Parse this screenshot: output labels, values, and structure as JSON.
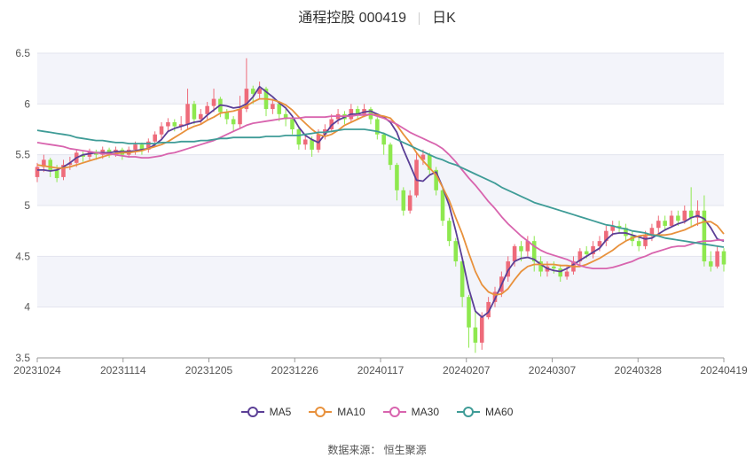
{
  "title": {
    "name": "通程控股 000419",
    "period": "日K"
  },
  "source": "数据来源： 恒生聚源",
  "chart_data": {
    "type": "candlestick",
    "ylim": [
      3.5,
      6.5
    ],
    "yticks": [
      3.5,
      4,
      4.5,
      5,
      5.5,
      6,
      6.5
    ],
    "xticks": [
      "20231024",
      "20231114",
      "20231205",
      "20231226",
      "20240117",
      "20240207",
      "20240307",
      "20240328",
      "20240419"
    ],
    "grid": true,
    "legend_position": "bottom",
    "colors": {
      "up": "#ee6b7a",
      "down": "#8ee84f",
      "band": "#f3f4fa"
    },
    "series": [
      {
        "name": "MA5",
        "color": "#5b3f96",
        "values": [
          5.35,
          5.35,
          5.34,
          5.35,
          5.38,
          5.42,
          5.47,
          5.5,
          5.51,
          5.52,
          5.52,
          5.52,
          5.53,
          5.53,
          5.53,
          5.54,
          5.55,
          5.56,
          5.6,
          5.65,
          5.73,
          5.76,
          5.78,
          5.8,
          5.82,
          5.83,
          5.89,
          5.94,
          5.99,
          5.98,
          5.96,
          5.97,
          6.0,
          6.07,
          6.17,
          6.12,
          6.07,
          6.01,
          5.96,
          5.88,
          5.77,
          5.69,
          5.65,
          5.62,
          5.7,
          5.79,
          5.84,
          5.87,
          5.9,
          5.9,
          5.92,
          5.93,
          5.9,
          5.87,
          5.82,
          5.72,
          5.55,
          5.4,
          5.25,
          5.24,
          5.3,
          5.33,
          5.18,
          5.0,
          4.75,
          4.48,
          4.18,
          3.96,
          3.9,
          3.95,
          4.08,
          4.22,
          4.36,
          4.45,
          4.48,
          4.49,
          4.47,
          4.42,
          4.38,
          4.36,
          4.35,
          4.38,
          4.42,
          4.46,
          4.5,
          4.54,
          4.58,
          4.66,
          4.72,
          4.73,
          4.73,
          4.71,
          4.69,
          4.67,
          4.68,
          4.72,
          4.76,
          4.79,
          4.82,
          4.84,
          4.88,
          4.9,
          4.87,
          4.78,
          4.67,
          4.65
        ]
      },
      {
        "name": "MA10",
        "color": "#e8913c",
        "values": [
          5.4,
          5.39,
          5.38,
          5.37,
          5.37,
          5.38,
          5.4,
          5.42,
          5.44,
          5.46,
          5.48,
          5.5,
          5.51,
          5.52,
          5.52,
          5.53,
          5.54,
          5.56,
          5.58,
          5.6,
          5.63,
          5.67,
          5.71,
          5.75,
          5.78,
          5.8,
          5.84,
          5.87,
          5.91,
          5.92,
          5.93,
          5.95,
          5.98,
          6.02,
          6.05,
          6.05,
          6.04,
          6.02,
          5.99,
          5.94,
          5.87,
          5.81,
          5.75,
          5.7,
          5.68,
          5.7,
          5.74,
          5.79,
          5.82,
          5.85,
          5.88,
          5.9,
          5.89,
          5.88,
          5.86,
          5.79,
          5.7,
          5.62,
          5.52,
          5.44,
          5.37,
          5.3,
          5.18,
          5.05,
          4.88,
          4.72,
          4.53,
          4.35,
          4.22,
          4.15,
          4.12,
          4.13,
          4.18,
          4.27,
          4.35,
          4.4,
          4.42,
          4.42,
          4.42,
          4.42,
          4.41,
          4.41,
          4.4,
          4.4,
          4.42,
          4.45,
          4.48,
          4.52,
          4.56,
          4.61,
          4.65,
          4.68,
          4.7,
          4.71,
          4.71,
          4.71,
          4.71,
          4.72,
          4.74,
          4.76,
          4.79,
          4.82,
          4.84,
          4.84,
          4.8,
          4.72
        ]
      },
      {
        "name": "MA30",
        "color": "#d864ae",
        "values": [
          5.62,
          5.61,
          5.6,
          5.59,
          5.58,
          5.56,
          5.55,
          5.54,
          5.53,
          5.52,
          5.51,
          5.51,
          5.5,
          5.49,
          5.48,
          5.48,
          5.47,
          5.47,
          5.48,
          5.49,
          5.51,
          5.52,
          5.54,
          5.56,
          5.58,
          5.6,
          5.62,
          5.64,
          5.67,
          5.7,
          5.73,
          5.76,
          5.79,
          5.81,
          5.82,
          5.83,
          5.84,
          5.85,
          5.86,
          5.86,
          5.86,
          5.87,
          5.87,
          5.87,
          5.87,
          5.88,
          5.88,
          5.88,
          5.88,
          5.89,
          5.89,
          5.9,
          5.88,
          5.86,
          5.83,
          5.8,
          5.76,
          5.72,
          5.69,
          5.66,
          5.63,
          5.6,
          5.56,
          5.5,
          5.43,
          5.35,
          5.27,
          5.2,
          5.12,
          5.04,
          4.97,
          4.89,
          4.82,
          4.76,
          4.7,
          4.65,
          4.6,
          4.56,
          4.53,
          4.51,
          4.49,
          4.47,
          4.44,
          4.41,
          4.39,
          4.38,
          4.38,
          4.38,
          4.39,
          4.41,
          4.43,
          4.45,
          4.48,
          4.5,
          4.53,
          4.55,
          4.57,
          4.59,
          4.6,
          4.6,
          4.62,
          4.64,
          4.65,
          4.65,
          4.66,
          4.66
        ]
      },
      {
        "name": "MA60",
        "color": "#3f9c97",
        "values": [
          5.74,
          5.73,
          5.72,
          5.71,
          5.7,
          5.69,
          5.67,
          5.66,
          5.65,
          5.64,
          5.64,
          5.63,
          5.62,
          5.62,
          5.61,
          5.61,
          5.61,
          5.61,
          5.61,
          5.62,
          5.62,
          5.62,
          5.63,
          5.63,
          5.63,
          5.64,
          5.64,
          5.65,
          5.66,
          5.66,
          5.67,
          5.67,
          5.67,
          5.67,
          5.67,
          5.68,
          5.68,
          5.68,
          5.69,
          5.69,
          5.69,
          5.7,
          5.71,
          5.72,
          5.72,
          5.73,
          5.74,
          5.75,
          5.75,
          5.75,
          5.75,
          5.74,
          5.73,
          5.71,
          5.68,
          5.65,
          5.62,
          5.59,
          5.56,
          5.53,
          5.5,
          5.47,
          5.45,
          5.42,
          5.4,
          5.37,
          5.34,
          5.31,
          5.28,
          5.25,
          5.22,
          5.18,
          5.15,
          5.12,
          5.09,
          5.06,
          5.03,
          5.01,
          4.99,
          4.97,
          4.95,
          4.93,
          4.91,
          4.89,
          4.87,
          4.85,
          4.83,
          4.81,
          4.8,
          4.78,
          4.77,
          4.75,
          4.74,
          4.73,
          4.71,
          4.7,
          4.68,
          4.67,
          4.66,
          4.65,
          4.64,
          4.63,
          4.62,
          4.61,
          4.6,
          4.59
        ]
      }
    ],
    "candles": [
      [
        5.28,
        5.38,
        5.42,
        5.23
      ],
      [
        5.38,
        5.45,
        5.5,
        5.33
      ],
      [
        5.45,
        5.35,
        5.47,
        5.28
      ],
      [
        5.35,
        5.27,
        5.4,
        5.23
      ],
      [
        5.28,
        5.4,
        5.45,
        5.25
      ],
      [
        5.4,
        5.42,
        5.48,
        5.35
      ],
      [
        5.42,
        5.52,
        5.55,
        5.38
      ],
      [
        5.5,
        5.48,
        5.53,
        5.43
      ],
      [
        5.48,
        5.53,
        5.56,
        5.45
      ],
      [
        5.53,
        5.5,
        5.55,
        5.45
      ],
      [
        5.5,
        5.55,
        5.58,
        5.46
      ],
      [
        5.55,
        5.52,
        5.57,
        5.47
      ],
      [
        5.52,
        5.55,
        5.58,
        5.48
      ],
      [
        5.55,
        5.5,
        5.57,
        5.45
      ],
      [
        5.5,
        5.55,
        5.58,
        5.47
      ],
      [
        5.55,
        5.6,
        5.63,
        5.5
      ],
      [
        5.6,
        5.55,
        5.62,
        5.5
      ],
      [
        5.55,
        5.63,
        5.66,
        5.52
      ],
      [
        5.63,
        5.7,
        5.73,
        5.58
      ],
      [
        5.7,
        5.78,
        5.82,
        5.65
      ],
      [
        5.78,
        5.82,
        5.86,
        5.73
      ],
      [
        5.82,
        5.78,
        5.85,
        5.73
      ],
      [
        5.78,
        5.8,
        5.88,
        5.74
      ],
      [
        5.8,
        6.0,
        6.15,
        5.75
      ],
      [
        6.0,
        5.85,
        6.03,
        5.8
      ],
      [
        5.85,
        5.9,
        5.95,
        5.8
      ],
      [
        5.9,
        5.98,
        6.02,
        5.85
      ],
      [
        5.98,
        6.05,
        6.15,
        5.92
      ],
      [
        6.05,
        5.92,
        6.07,
        5.87
      ],
      [
        5.92,
        5.85,
        5.95,
        5.8
      ],
      [
        5.85,
        5.8,
        5.88,
        5.73
      ],
      [
        5.8,
        5.95,
        6.08,
        5.76
      ],
      [
        5.95,
        6.15,
        6.45,
        5.92
      ],
      [
        6.15,
        6.1,
        6.18,
        6.0
      ],
      [
        6.1,
        6.15,
        6.22,
        6.05
      ],
      [
        6.15,
        5.95,
        6.17,
        5.88
      ],
      [
        5.95,
        6.0,
        6.05,
        5.9
      ],
      [
        6.0,
        5.9,
        6.02,
        5.83
      ],
      [
        5.9,
        5.85,
        5.95,
        5.78
      ],
      [
        5.85,
        5.75,
        5.88,
        5.7
      ],
      [
        5.75,
        5.6,
        5.78,
        5.55
      ],
      [
        5.6,
        5.65,
        5.7,
        5.55
      ],
      [
        5.65,
        5.55,
        5.68,
        5.48
      ],
      [
        5.55,
        5.7,
        5.75,
        5.52
      ],
      [
        5.7,
        5.75,
        5.8,
        5.65
      ],
      [
        5.75,
        5.85,
        5.9,
        5.72
      ],
      [
        5.85,
        5.9,
        5.95,
        5.8
      ],
      [
        5.9,
        5.85,
        5.93,
        5.8
      ],
      [
        5.85,
        5.95,
        6.0,
        5.82
      ],
      [
        5.95,
        5.9,
        5.98,
        5.85
      ],
      [
        5.9,
        5.95,
        6.0,
        5.87
      ],
      [
        5.95,
        5.85,
        5.97,
        5.8
      ],
      [
        5.85,
        5.7,
        5.87,
        5.65
      ],
      [
        5.7,
        5.6,
        5.72,
        5.5
      ],
      [
        5.6,
        5.4,
        5.62,
        5.35
      ],
      [
        5.4,
        5.15,
        5.42,
        5.05
      ],
      [
        5.15,
        4.95,
        5.18,
        4.9
      ],
      [
        4.95,
        5.1,
        5.15,
        4.92
      ],
      [
        5.1,
        5.45,
        5.52,
        5.08
      ],
      [
        5.45,
        5.5,
        5.55,
        5.4
      ],
      [
        5.5,
        5.35,
        5.52,
        5.3
      ],
      [
        5.35,
        5.15,
        5.38,
        5.1
      ],
      [
        5.15,
        4.85,
        5.18,
        4.8
      ],
      [
        4.85,
        4.65,
        4.88,
        4.6
      ],
      [
        4.65,
        4.45,
        4.68,
        4.4
      ],
      [
        4.45,
        4.1,
        4.48,
        4.0
      ],
      [
        4.1,
        3.8,
        4.12,
        3.6
      ],
      [
        3.8,
        3.65,
        3.95,
        3.55
      ],
      [
        3.65,
        3.9,
        3.95,
        3.58
      ],
      [
        3.9,
        4.05,
        4.1,
        3.88
      ],
      [
        4.05,
        4.15,
        4.2,
        4.0
      ],
      [
        4.15,
        4.3,
        4.35,
        4.1
      ],
      [
        4.3,
        4.45,
        4.5,
        4.25
      ],
      [
        4.45,
        4.6,
        4.62,
        4.4
      ],
      [
        4.6,
        4.55,
        4.65,
        4.45
      ],
      [
        4.55,
        4.65,
        4.7,
        4.5
      ],
      [
        4.65,
        4.45,
        4.7,
        4.35
      ],
      [
        4.45,
        4.35,
        4.5,
        4.3
      ],
      [
        4.35,
        4.4,
        4.45,
        4.3
      ],
      [
        4.4,
        4.38,
        4.45,
        4.33
      ],
      [
        4.38,
        4.3,
        4.42,
        4.25
      ],
      [
        4.3,
        4.35,
        4.4,
        4.27
      ],
      [
        4.35,
        4.45,
        4.5,
        4.32
      ],
      [
        4.45,
        4.55,
        4.58,
        4.4
      ],
      [
        4.55,
        4.52,
        4.6,
        4.48
      ],
      [
        4.52,
        4.6,
        4.65,
        4.48
      ],
      [
        4.6,
        4.65,
        4.7,
        4.55
      ],
      [
        4.65,
        4.75,
        4.8,
        4.6
      ],
      [
        4.75,
        4.8,
        4.85,
        4.7
      ],
      [
        4.8,
        4.78,
        4.85,
        4.72
      ],
      [
        4.78,
        4.7,
        4.82,
        4.65
      ],
      [
        4.7,
        4.65,
        4.75,
        4.6
      ],
      [
        4.65,
        4.6,
        4.7,
        4.55
      ],
      [
        4.6,
        4.7,
        4.75,
        4.57
      ],
      [
        4.7,
        4.78,
        4.82,
        4.65
      ],
      [
        4.78,
        4.85,
        4.9,
        4.73
      ],
      [
        4.85,
        4.8,
        4.9,
        4.75
      ],
      [
        4.8,
        4.9,
        4.95,
        4.78
      ],
      [
        4.9,
        4.85,
        4.95,
        4.8
      ],
      [
        4.85,
        4.95,
        5.0,
        4.82
      ],
      [
        4.95,
        4.88,
        5.18,
        4.8
      ],
      [
        4.88,
        4.95,
        5.05,
        4.8
      ],
      [
        4.95,
        4.45,
        5.1,
        4.4
      ],
      [
        4.45,
        4.4,
        4.55,
        4.35
      ],
      [
        4.4,
        4.55,
        4.6,
        4.38
      ],
      [
        4.55,
        4.42,
        4.58,
        4.35
      ]
    ]
  }
}
